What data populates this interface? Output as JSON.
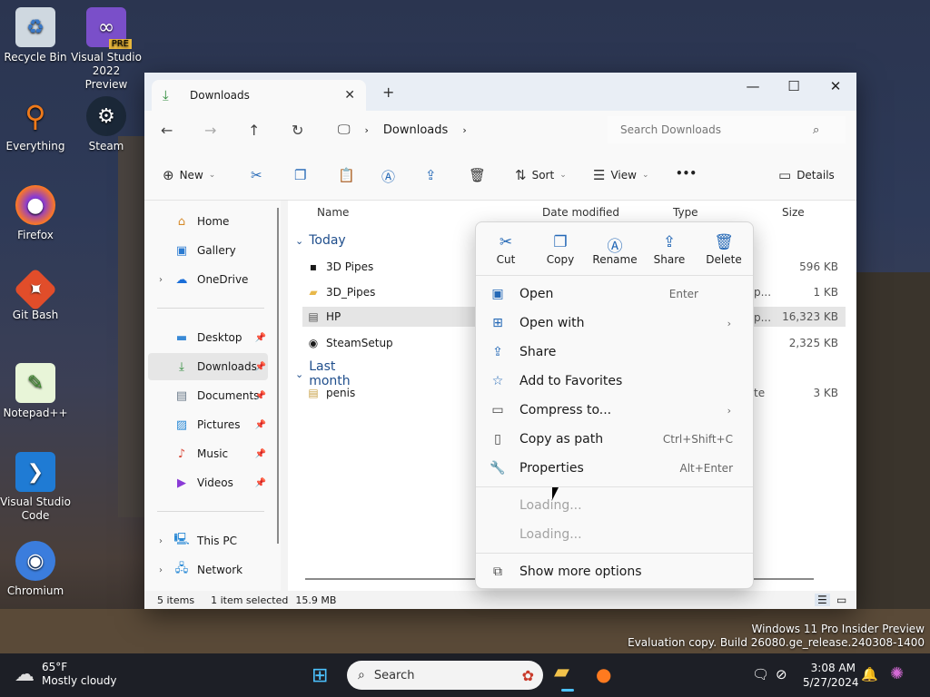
{
  "desktop_icons": [
    {
      "label": "Recycle Bin",
      "icon": "recycle-bin-icon"
    },
    {
      "label": "Visual Studio 2022 Preview",
      "icon": "visual-studio-icon",
      "badge": "PRE"
    },
    {
      "label": "Everything",
      "icon": "everything-icon"
    },
    {
      "label": "Steam",
      "icon": "steam-icon"
    },
    {
      "label": "Firefox",
      "icon": "firefox-icon"
    },
    {
      "label": "Git Bash",
      "icon": "git-bash-icon"
    },
    {
      "label": "Notepad++",
      "icon": "notepadpp-icon"
    },
    {
      "label": "Visual Studio Code",
      "icon": "vscode-icon"
    },
    {
      "label": "Chromium",
      "icon": "chromium-icon"
    }
  ],
  "window": {
    "tab_title": "Downloads",
    "nav": {
      "breadcrumb": "Downloads"
    },
    "search_placeholder": "Search Downloads",
    "commands": {
      "new": "New",
      "sort": "Sort",
      "view": "View",
      "more": "•••",
      "details": "Details"
    },
    "sidebar": {
      "home": "Home",
      "gallery": "Gallery",
      "onedrive": "OneDrive",
      "desktop": "Desktop",
      "downloads": "Downloads",
      "documents": "Documents",
      "pictures": "Pictures",
      "music": "Music",
      "videos": "Videos",
      "thispc": "This PC",
      "network": "Network"
    },
    "columns": {
      "name": "Name",
      "date": "Date modified",
      "type": "Type",
      "size": "Size"
    },
    "groups": {
      "today": "Today",
      "last_month": "Last month"
    },
    "files": [
      {
        "name": "3D Pipes",
        "type": "",
        "size": "596 KB"
      },
      {
        "name": "3D_Pipes",
        "type": "p...",
        "size": "1 KB"
      },
      {
        "name": "HP",
        "type": "p...",
        "size": "16,323 KB"
      },
      {
        "name": "SteamSetup",
        "type": "",
        "size": "2,325 KB"
      },
      {
        "name": "penis",
        "type": "te",
        "size": "3 KB"
      }
    ],
    "status": {
      "items": "5 items",
      "selected": "1 item selected",
      "size": "15.9 MB"
    }
  },
  "context_menu": {
    "quick_actions": {
      "cut": "Cut",
      "copy": "Copy",
      "rename": "Rename",
      "share": "Share",
      "delete": "Delete"
    },
    "items": {
      "open": "Open",
      "open_accel": "Enter",
      "open_with": "Open with",
      "share": "Share",
      "favorites": "Add to Favorites",
      "compress": "Compress to...",
      "copy_path": "Copy as path",
      "copy_path_accel": "Ctrl+Shift+C",
      "properties": "Properties",
      "properties_accel": "Alt+Enter",
      "loading1": "Loading...",
      "loading2": "Loading...",
      "more": "Show more options"
    }
  },
  "watermark": {
    "line1": "Windows 11 Pro Insider Preview",
    "line2": "Evaluation copy. Build 26080.ge_release.240308-1400"
  },
  "taskbar": {
    "weather_temp": "65°F",
    "weather_desc": "Mostly cloudy",
    "search": "Search",
    "time": "3:08 AM",
    "date": "5/27/2024"
  }
}
